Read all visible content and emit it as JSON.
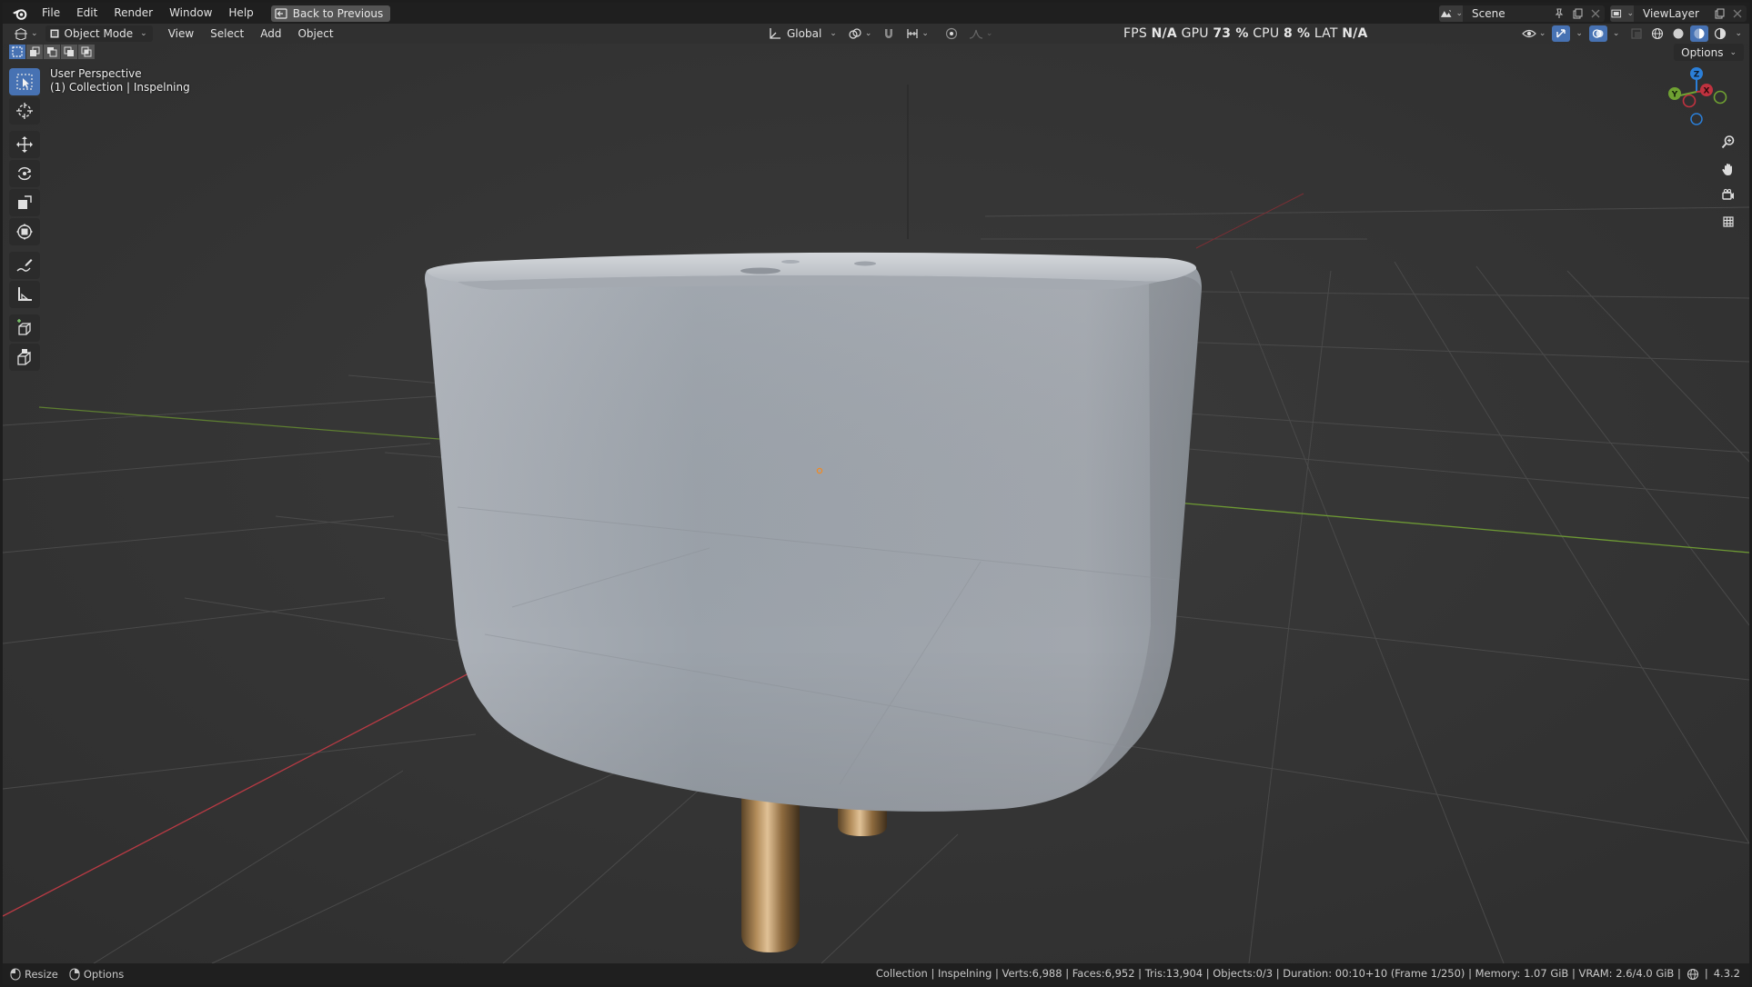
{
  "menubar": {
    "items": [
      "File",
      "Edit",
      "Render",
      "Window",
      "Help"
    ],
    "back_button": "Back to Previous",
    "scene_name": "Scene",
    "view_layer": "ViewLayer"
  },
  "viewport_header": {
    "mode": "Object Mode",
    "menus": [
      "View",
      "Select",
      "Add",
      "Object"
    ],
    "orientation": "Global",
    "options_label": "Options"
  },
  "stats": {
    "fps_label": "FPS",
    "fps_value": "N/A",
    "gpu_label": "GPU",
    "gpu_value": "73 %",
    "cpu_label": "CPU",
    "cpu_value": "8 %",
    "lat_label": "LAT",
    "lat_value": "N/A"
  },
  "viewport": {
    "perspective": "User Perspective",
    "collection": "(1) Collection | Inspelning"
  },
  "toolbar": {
    "tools": [
      "select-box",
      "cursor",
      "move",
      "rotate",
      "scale",
      "transform",
      "annotate",
      "measure",
      "add-cube",
      "extrude"
    ]
  },
  "gizmo": {
    "x_label": "X",
    "y_label": "Y",
    "z_label": "Z"
  },
  "statusbar": {
    "left": [
      "Resize",
      "Options"
    ],
    "info": "Collection | Inspelning | Verts:6,988 | Faces:6,952 | Tris:13,904 | Objects:0/3 | Duration: 00:10+10 (Frame 1/250) | Memory: 1.07 GiB | VRAM: 2.6/4.0 GiB |",
    "version": "4.3.2"
  },
  "colors": {
    "accent": "#4772b3",
    "x_axis": "#c0323f",
    "y_axis": "#6fa132",
    "z_axis": "#2b7fd8",
    "origin": "#f08a24",
    "brass": "#a8835a"
  }
}
